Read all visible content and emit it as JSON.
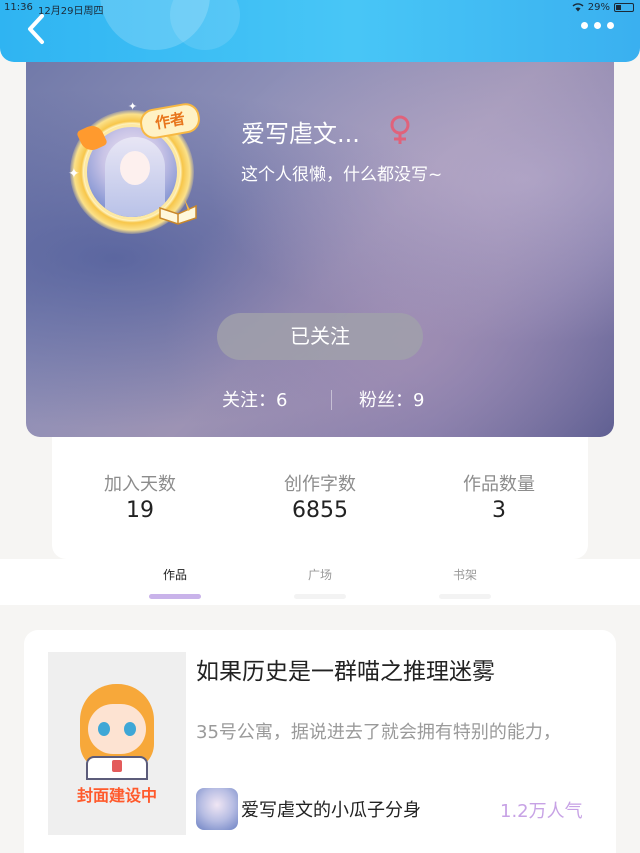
{
  "status_bar": {
    "time": "11:36",
    "date": "12月29日周四",
    "battery": "29%"
  },
  "profile": {
    "username": "爱写虐文...",
    "bio": "这个人很懒，什么都没写~",
    "badge": "作者",
    "gender_icon": "female-symbol-icon",
    "follow_button": "已关注",
    "following_label": "关注：6",
    "followers_label": "粉丝：9"
  },
  "stats": [
    {
      "label": "加入天数",
      "value": "19"
    },
    {
      "label": "创作字数",
      "value": "6855"
    },
    {
      "label": "作品数量",
      "value": "3"
    }
  ],
  "tabs": [
    {
      "label": "作品",
      "active": true
    },
    {
      "label": "广场",
      "active": false
    },
    {
      "label": "书架",
      "active": false
    }
  ],
  "works": [
    {
      "cover_label": "封面建设中",
      "title": "如果历史是一群喵之推理迷雾",
      "description": "35号公寓，据说进去了就会拥有特别的能力，",
      "author": "爱写虐文的小瓜子分身",
      "popularity": "1.2万人气"
    }
  ],
  "colors": {
    "header": "#3ab4f2",
    "accent": "#c7a2e5",
    "gender": "#e0627b"
  }
}
